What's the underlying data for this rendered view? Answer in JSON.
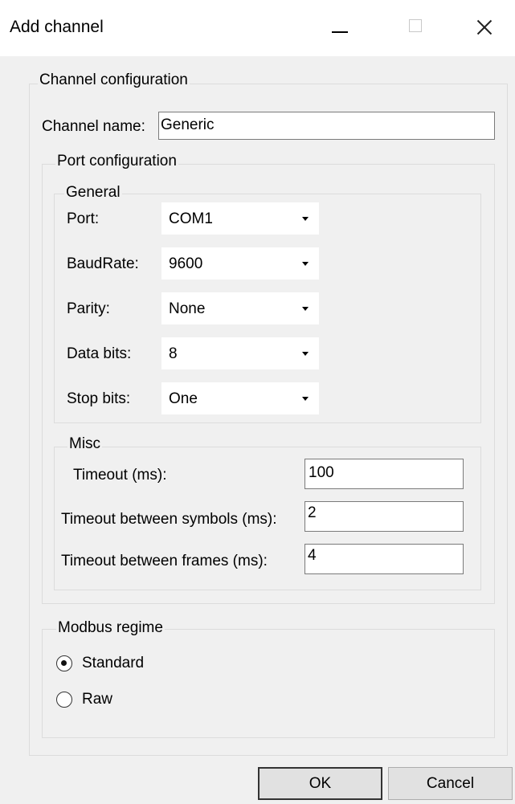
{
  "window": {
    "title": "Add channel",
    "controls": {
      "minimize": "minimize-icon",
      "maximize": "maximize-icon",
      "close": "close-icon"
    }
  },
  "channel_config": {
    "legend": "Channel configuration",
    "name_label": "Channel name:",
    "name_value": "Generic"
  },
  "port_config": {
    "legend": "Port configuration",
    "general": {
      "legend": "General",
      "port_label": "Port:",
      "port_value": "COM1",
      "baud_label": "BaudRate:",
      "baud_value": "9600",
      "parity_label": "Parity:",
      "parity_value": "None",
      "databits_label": "Data bits:",
      "databits_value": "8",
      "stopbits_label": "Stop bits:",
      "stopbits_value": "One"
    },
    "misc": {
      "legend": "Misc",
      "timeout_label": "Timeout (ms):",
      "timeout_value": "100",
      "symbols_label": "Timeout between symbols (ms):",
      "symbols_value": "2",
      "frames_label": "Timeout between frames (ms):",
      "frames_value": "4"
    }
  },
  "modbus": {
    "legend": "Modbus regime",
    "standard_label": "Standard",
    "standard_selected": true,
    "raw_label": "Raw",
    "raw_selected": false
  },
  "buttons": {
    "ok": "OK",
    "cancel": "Cancel"
  }
}
